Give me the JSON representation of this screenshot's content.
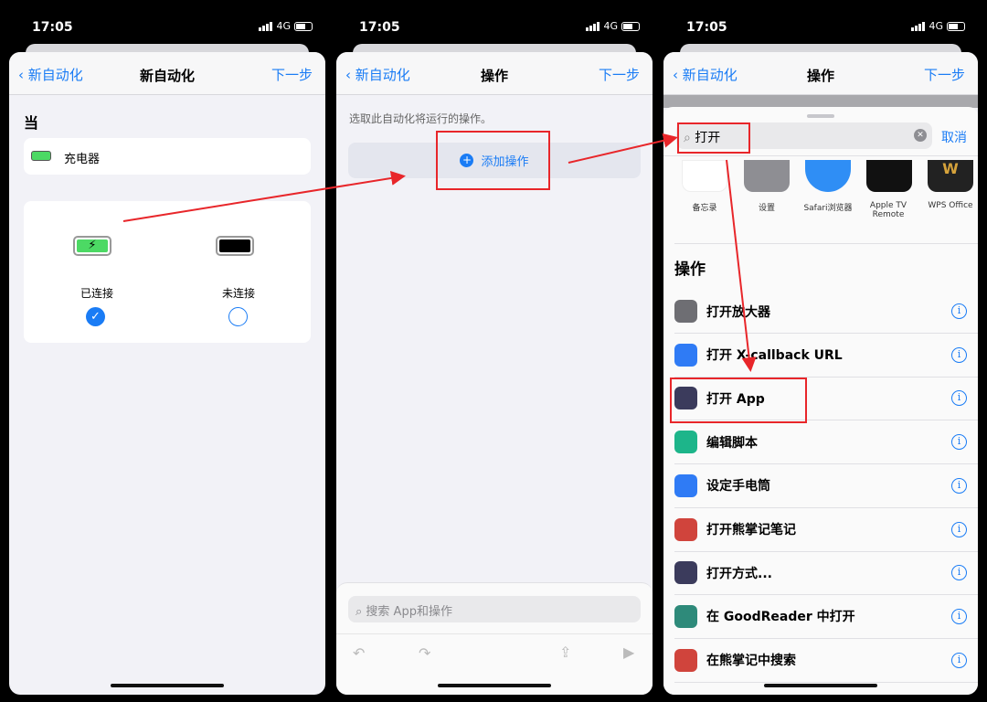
{
  "status": {
    "time": "17:05",
    "network": "4G"
  },
  "screen1": {
    "back": "新自动化",
    "title": "新自动化",
    "next": "下一步",
    "section": "当",
    "trigger": "充电器",
    "options": [
      {
        "label": "已连接",
        "checked": true
      },
      {
        "label": "未连接",
        "checked": false
      }
    ]
  },
  "screen2": {
    "back": "新自动化",
    "title": "操作",
    "next": "下一步",
    "hint": "选取此自动化将运行的操作。",
    "add": "添加操作",
    "search_placeholder": "搜索 App和操作"
  },
  "screen3": {
    "back": "新自动化",
    "title": "操作",
    "next": "下一步",
    "search_value": "打开",
    "cancel": "取消",
    "apps": [
      "备忘录",
      "设置",
      "Safari浏览器",
      "Apple TV Remote",
      "WPS Office"
    ],
    "section": "操作",
    "actions": [
      {
        "label": "打开放大器",
        "color": "#6e6e73",
        "icon": "magnifier-icon"
      },
      {
        "label": "打开 X-callback URL",
        "color": "#2f7bf5",
        "icon": "link-icon"
      },
      {
        "label": "打开 App",
        "color": "#3b3b5c",
        "icon": "app-grid-icon"
      },
      {
        "label": "编辑脚本",
        "color": "#1db58a",
        "icon": "script-icon"
      },
      {
        "label": "设定手电筒",
        "color": "#2f7bf5",
        "icon": "flashlight-icon"
      },
      {
        "label": "打开熊掌记笔记",
        "color": "#d0443c",
        "icon": "bear-icon"
      },
      {
        "label": "打开方式...",
        "color": "#3b3b5c",
        "icon": "app-grid-icon"
      },
      {
        "label": "在 GoodReader 中打开",
        "color": "#2e8a7a",
        "icon": "eye-icon"
      },
      {
        "label": "在熊掌记中搜索",
        "color": "#d0443c",
        "icon": "bear-icon"
      }
    ]
  },
  "colors": {
    "accent": "#1a7cf5",
    "annotation": "#e8262a"
  }
}
